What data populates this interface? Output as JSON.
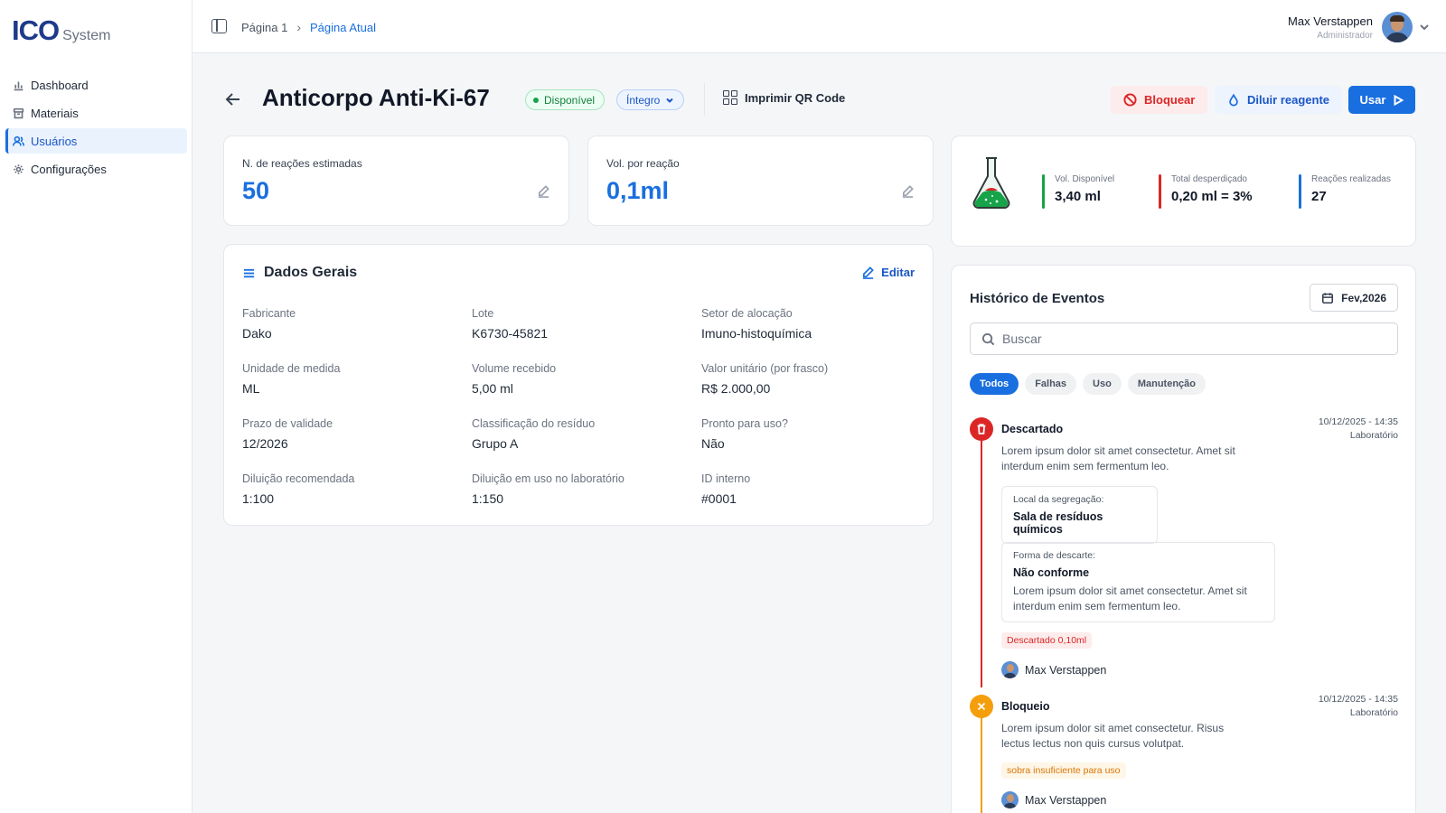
{
  "app": {
    "logo_main": "ICO",
    "logo_sub": "System"
  },
  "sidebar": {
    "items": [
      {
        "label": "Dashboard",
        "icon": "chart-icon",
        "active": false
      },
      {
        "label": "Materiais",
        "icon": "archive-icon",
        "active": false
      },
      {
        "label": "Usuários",
        "icon": "users-icon",
        "active": true
      },
      {
        "label": "Configurações",
        "icon": "gear-icon",
        "active": false
      }
    ]
  },
  "header": {
    "breadcrumb": [
      "Página 1",
      "Página Atual"
    ],
    "user": {
      "name": "Max Verstappen",
      "role": "Administrador"
    }
  },
  "title_row": {
    "title": "Anticorpo Anti-Ki-67",
    "status_badge": "Disponível",
    "state_select": "Íntegro",
    "qr_button": "Imprimir QR Code",
    "block_button": "Bloquear",
    "dilute_button": "Diluir reagente",
    "use_button": "Usar"
  },
  "stats": {
    "reactions": {
      "label": "N. de reações estimadas",
      "value": "50"
    },
    "volume": {
      "label": "Vol. por reação",
      "value": "0,1ml"
    }
  },
  "volume_card": {
    "metrics": [
      {
        "label": "Vol. Disponível",
        "value": "3,40 ml",
        "color": "#16a34a"
      },
      {
        "label": "Total desperdiçado",
        "value": "0,20 ml = 3%",
        "color": "#dc2626"
      },
      {
        "label": "Reações realizadas",
        "value": "27",
        "color": "#1a6fe0"
      }
    ]
  },
  "general": {
    "title": "Dados Gerais",
    "edit_label": "Editar",
    "fields": [
      {
        "label": "Fabricante",
        "value": "Dako"
      },
      {
        "label": "Lote",
        "value": "K6730-45821"
      },
      {
        "label": "Setor de alocação",
        "value": "Imuno-histoquímica"
      },
      {
        "label": "Unidade de medida",
        "value": "ML"
      },
      {
        "label": "Volume recebido",
        "value": "5,00 ml"
      },
      {
        "label": "Valor unitário (por frasco)",
        "value": "R$ 2.000,00"
      },
      {
        "label": "Prazo de validade",
        "value": "12/2026"
      },
      {
        "label": "Classificação do resíduo",
        "value": "Grupo A"
      },
      {
        "label": "Pronto para uso?",
        "value": "Não"
      },
      {
        "label": "Diluição recomendada",
        "value": "1:100"
      },
      {
        "label": "Diluição em uso no laboratório",
        "value": "1:150"
      },
      {
        "label": "ID interno",
        "value": "#0001"
      }
    ]
  },
  "events": {
    "title": "Histórico de Eventos",
    "date_filter": "Fev,2026",
    "search_placeholder": "Buscar",
    "filters": [
      "Todos",
      "Falhas",
      "Uso",
      "Manutenção"
    ],
    "items": [
      {
        "name": "Descartado",
        "date": "10/12/2025 - 14:35",
        "location": "Laboratório",
        "description": "Lorem ipsum dolor sit amet consectetur. Amet sit interdum enim sem fermentum leo.",
        "details": [
          {
            "label": "Local da segregação:",
            "value": "Sala de resíduos químicos"
          },
          {
            "label": "Forma de descarte:",
            "value": "Não conforme",
            "description": "Lorem ipsum dolor sit amet consectetur. Amet sit interdum enim sem fermentum leo."
          }
        ],
        "tag": "Descartado 0,10ml",
        "user": "Max Verstappen",
        "color": "#dc2626"
      },
      {
        "name": "Bloqueio",
        "date": "10/12/2025 - 14:35",
        "location": "Laboratório",
        "description": "Lorem ipsum dolor sit amet consectetur. Risus lectus lectus non quis cursus volutpat.",
        "tag": "sobra insuficiente para uso",
        "user": "Max Verstappen",
        "color": "#f59e0b"
      }
    ]
  }
}
